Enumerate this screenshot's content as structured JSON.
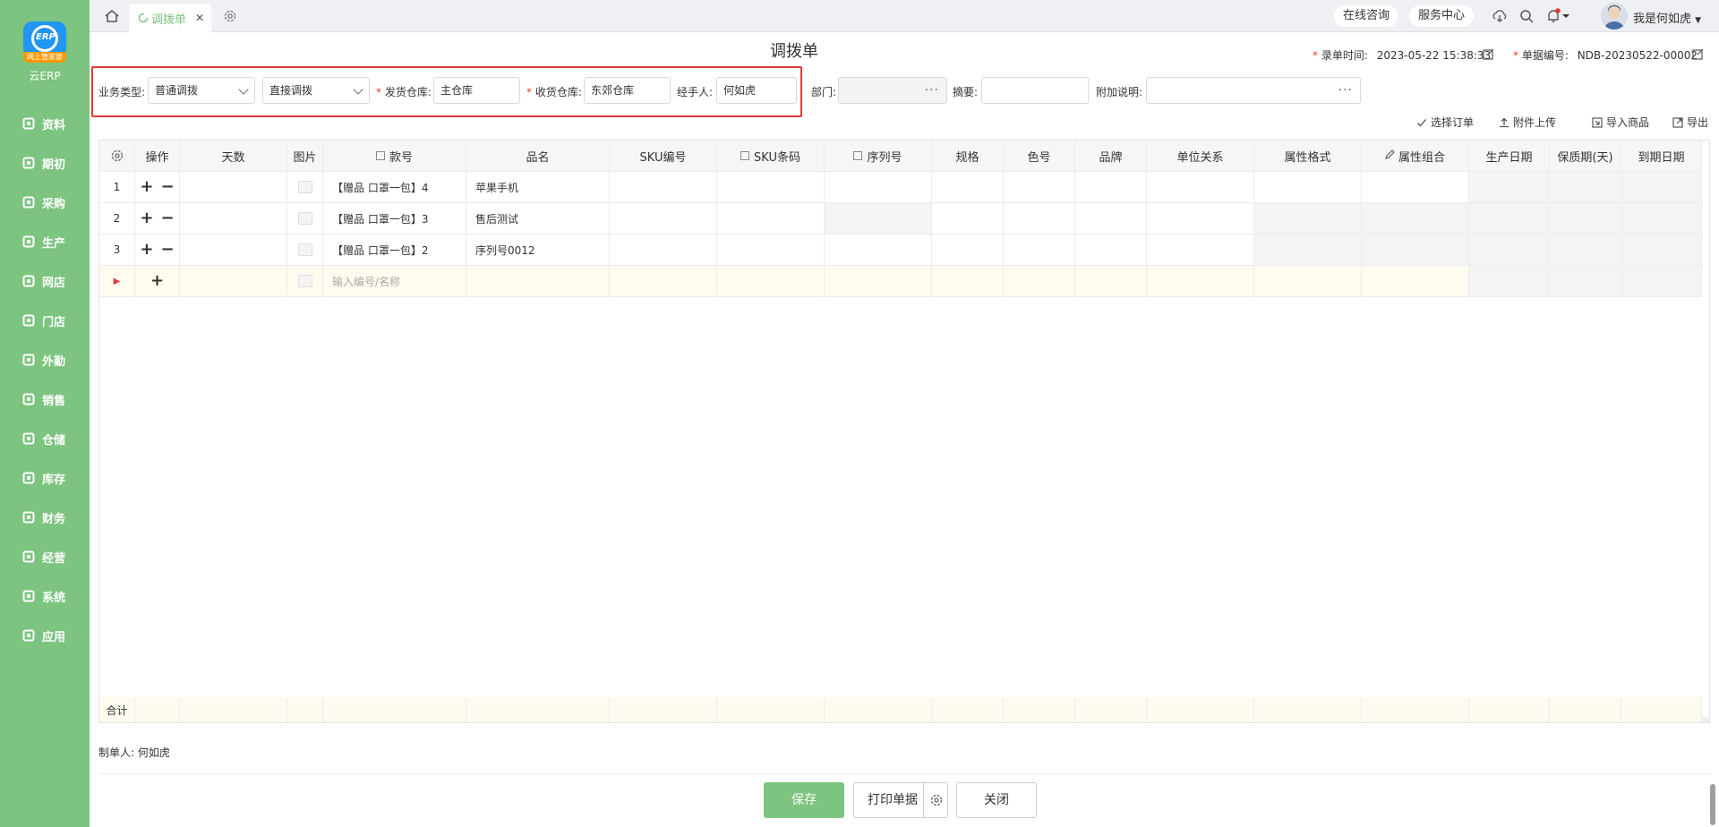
{
  "app": {
    "logo_band": "网上管家婆",
    "logo_text": "云ERP"
  },
  "sidebar": {
    "items": [
      {
        "label": "资料",
        "icon": "profile-icon"
      },
      {
        "label": "期初",
        "icon": "clock-icon"
      },
      {
        "label": "采购",
        "icon": "purchase-icon"
      },
      {
        "label": "生产",
        "icon": "production-icon"
      },
      {
        "label": "网店",
        "icon": "store-icon"
      },
      {
        "label": "门店",
        "icon": "pie-icon"
      },
      {
        "label": "外勤",
        "icon": "field-icon"
      },
      {
        "label": "销售",
        "icon": "sales-chart-icon"
      },
      {
        "label": "仓储",
        "icon": "warehouse-icon"
      },
      {
        "label": "库存",
        "icon": "home-stock-icon"
      },
      {
        "label": "财务",
        "icon": "finance-icon"
      },
      {
        "label": "经营",
        "icon": "business-icon"
      },
      {
        "label": "系统",
        "icon": "system-icon"
      },
      {
        "label": "应用",
        "icon": "apps-icon"
      }
    ]
  },
  "topbar": {
    "tab_label": "调拨单",
    "tab_close": "✕",
    "online_consult": "在线咨询",
    "service_center": "服务中心",
    "username": "我是何如虎"
  },
  "header": {
    "title": "调拨单",
    "entry_time_label": "录单时间:",
    "entry_time_value": "2023-05-22 15:38:33",
    "doc_no_label": "单据编号:",
    "doc_no_value": "NDB-20230522-00002"
  },
  "form": {
    "biz_type_label": "业务类型:",
    "biz_type_value": "普通调拨",
    "transfer_mode_value": "直接调拨",
    "from_wh_label": "发货仓库:",
    "from_wh_value": "主仓库",
    "to_wh_label": "收货仓库:",
    "to_wh_value": "东郊仓库",
    "handler_label": "经手人:",
    "handler_value": "何如虎",
    "dept_label": "部门:",
    "dept_value": "",
    "summary_label": "摘要:",
    "summary_value": "",
    "note_label": "附加说明:",
    "note_value": ""
  },
  "actions": {
    "select_order": "选择订单",
    "upload_attachment": "附件上传",
    "import_goods": "导入商品",
    "export": "导出"
  },
  "table": {
    "columns": [
      "",
      "操作",
      "天数",
      "图片",
      "款号",
      "品名",
      "SKU编号",
      "SKU条码",
      "序列号",
      "规格",
      "色号",
      "品牌",
      "单位关系",
      "属性格式",
      "属性组合",
      "生产日期",
      "保质期(天)",
      "到期日期"
    ],
    "rows": [
      {
        "no": "1",
        "style_no": "【赠品  口罩一包】4",
        "name": "苹果手机"
      },
      {
        "no": "2",
        "style_no": "【赠品  口罩一包】3",
        "name": "售后测试"
      },
      {
        "no": "3",
        "style_no": "【赠品  口罩一包】2",
        "name": "序列号0012"
      }
    ],
    "new_row_placeholder": "输入编号/名称",
    "new_row_marker": "▶",
    "total_label": "合计"
  },
  "footer": {
    "maker_label": "制单人:",
    "maker_value": "何如虎",
    "save": "保存",
    "print": "打印单据",
    "close": "关闭"
  },
  "colors": {
    "brand_green": "#7cc47f",
    "highlight_red": "#e53935"
  }
}
